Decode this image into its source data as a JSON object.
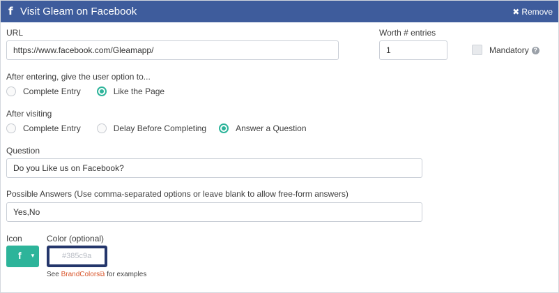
{
  "header": {
    "title": "Visit Gleam on Facebook",
    "remove_label": "Remove",
    "bg_color": "#3e5c9c"
  },
  "url": {
    "label": "URL",
    "value": "https://www.facebook.com/Gleamapp/"
  },
  "worth": {
    "label": "Worth # entries",
    "value": "1"
  },
  "mandatory": {
    "label": "Mandatory",
    "checked": false
  },
  "after_entering": {
    "label": "After entering, give the user option to...",
    "options": [
      {
        "label": "Complete Entry",
        "selected": false
      },
      {
        "label": "Like the Page",
        "selected": true
      }
    ]
  },
  "after_visiting": {
    "label": "After visiting",
    "options": [
      {
        "label": "Complete Entry",
        "selected": false
      },
      {
        "label": "Delay Before Completing",
        "selected": false
      },
      {
        "label": "Answer a Question",
        "selected": true
      }
    ]
  },
  "question": {
    "label": "Question",
    "value": "Do you Like us on Facebook?"
  },
  "answers": {
    "label": "Possible Answers (Use comma-separated options or leave blank to allow free-form answers)",
    "value": "Yes,No"
  },
  "icon": {
    "label": "Icon",
    "glyph": "f",
    "icon_name": "facebook-icon"
  },
  "color": {
    "label": "Color (optional)",
    "placeholder": "#385c9a"
  },
  "hint": {
    "prefix": "See",
    "link": "BrandColors",
    "suffix": "for examples"
  },
  "colors": {
    "accent": "#2db49a",
    "link": "#d8552b",
    "focus_border": "#24366b"
  }
}
